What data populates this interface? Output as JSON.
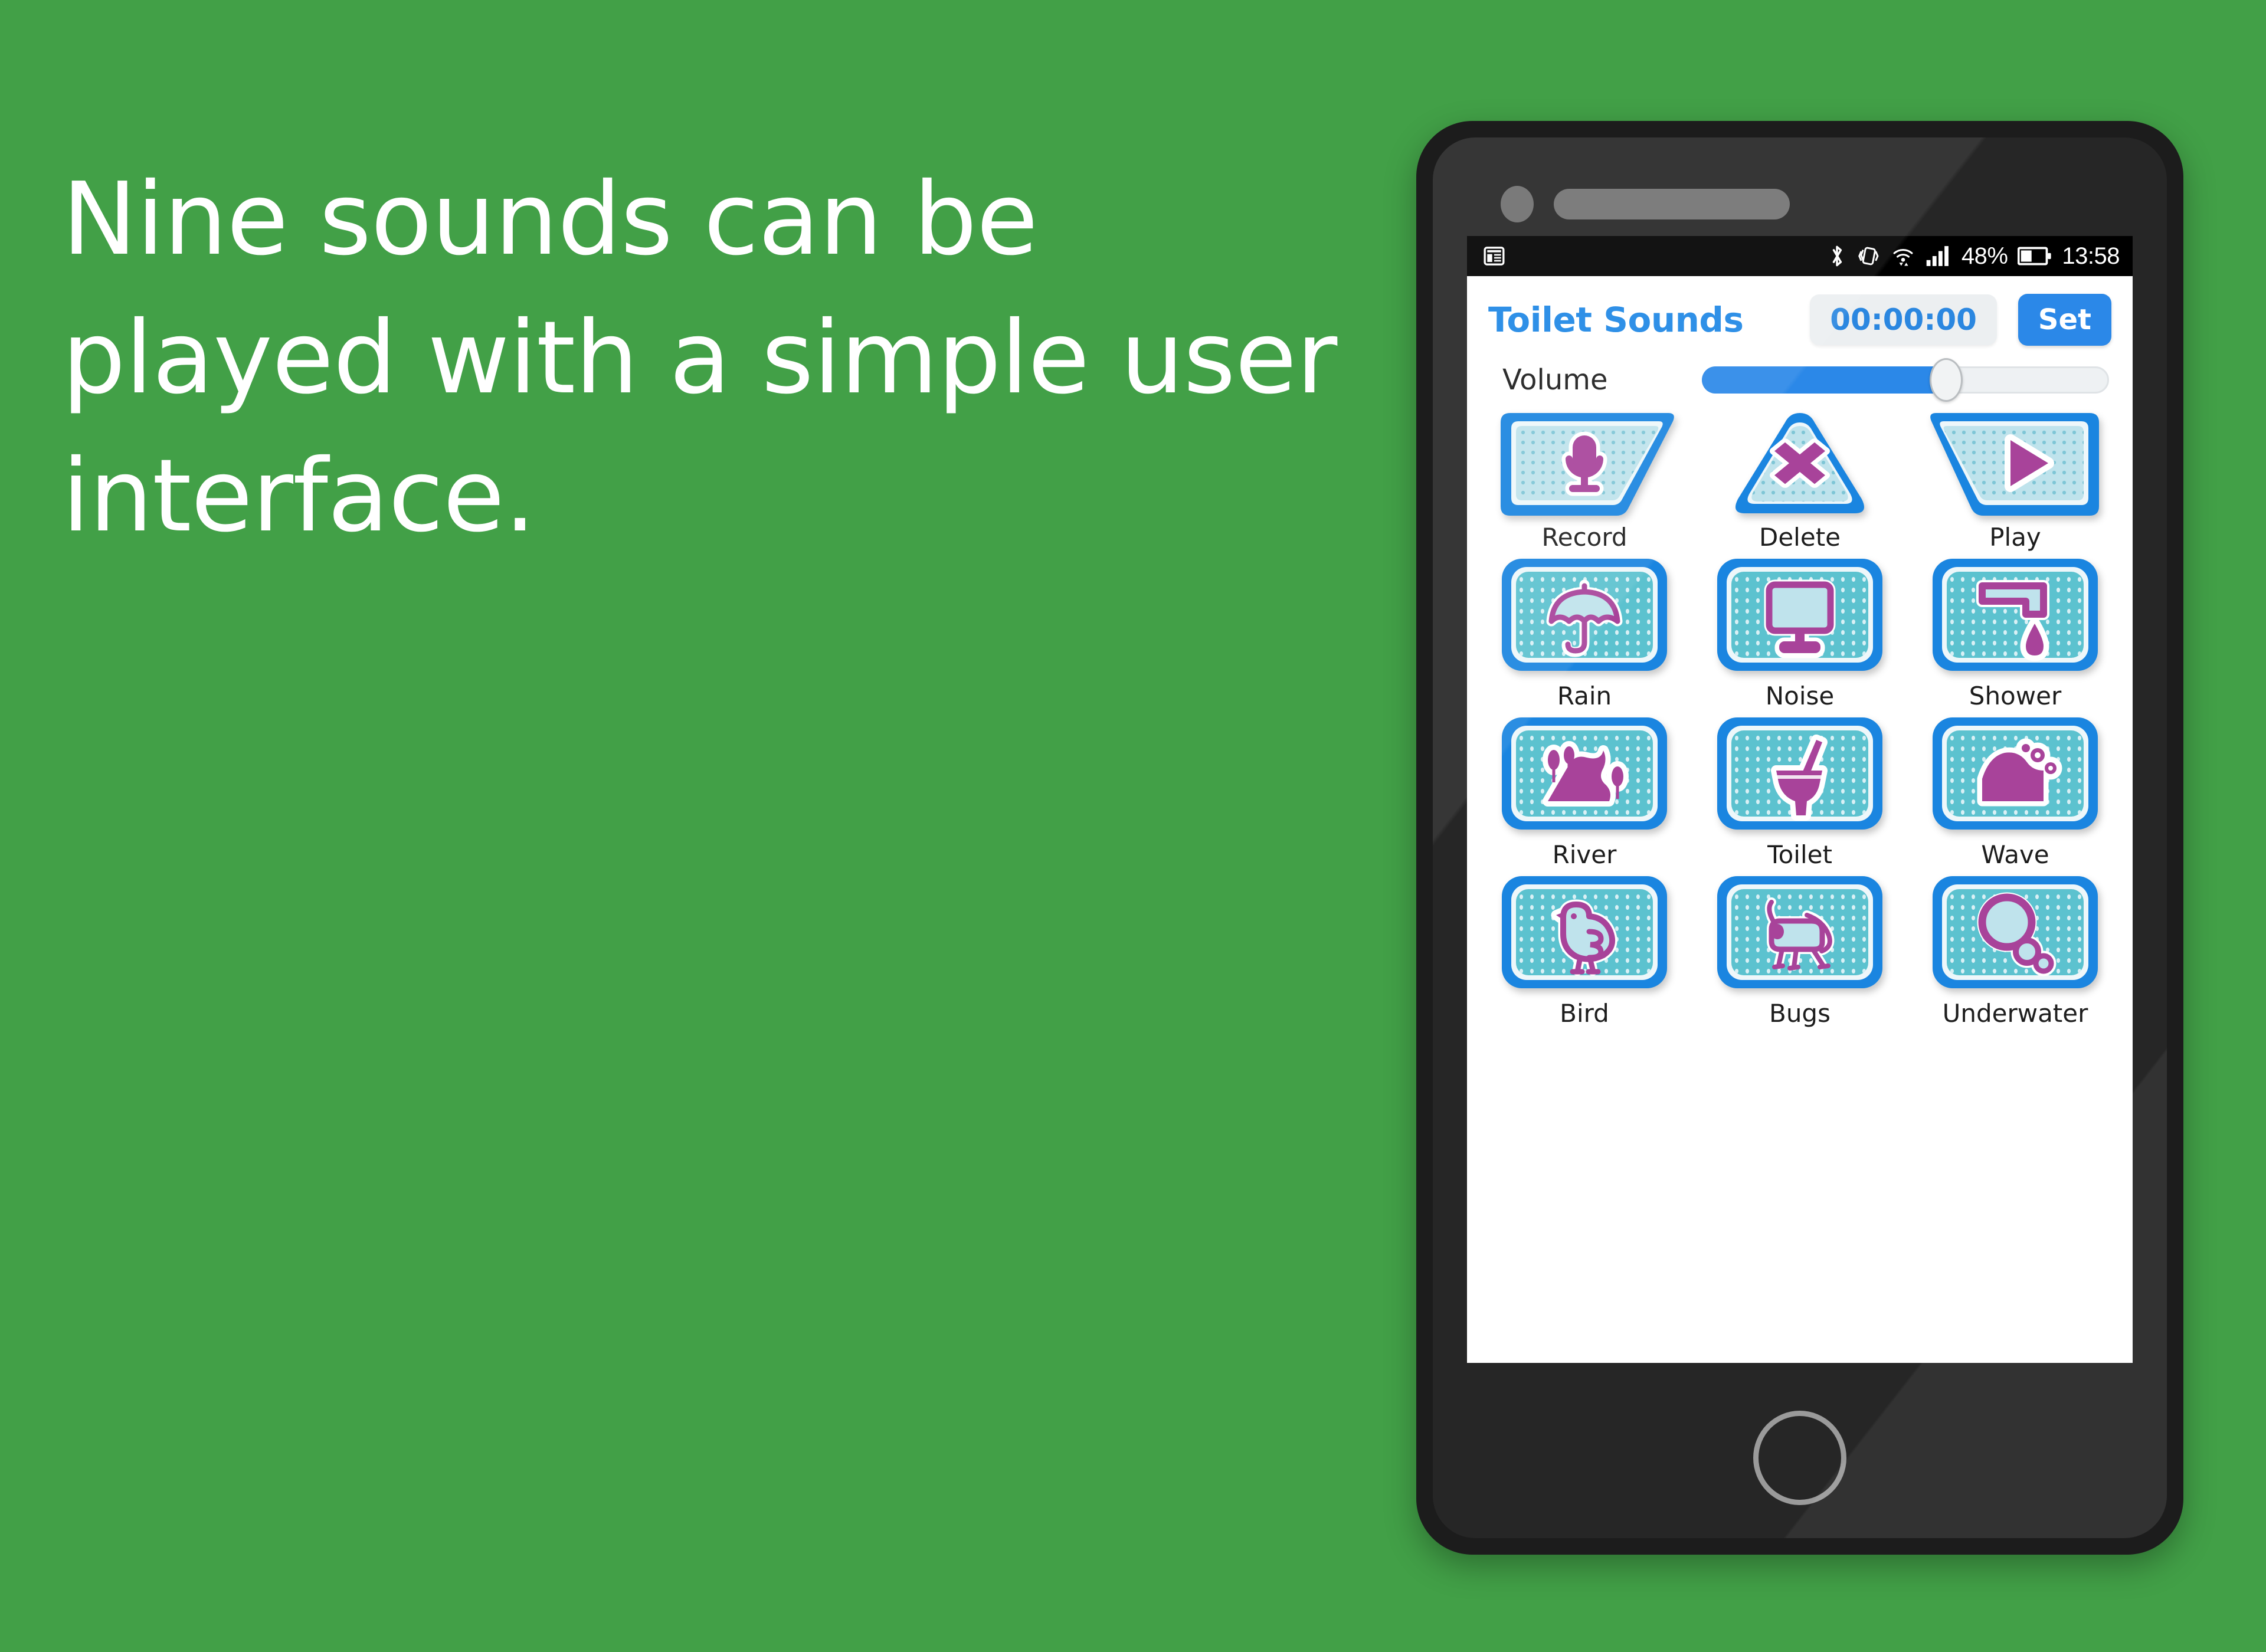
{
  "slide": {
    "headline": "Nine sounds can be played with a simple user interface.",
    "background_color": "#42a047"
  },
  "phone": {
    "body_color": "#1c1c1c",
    "camera_icon": "camera-dot-icon",
    "speaker_icon": "speaker-grille-icon",
    "home_button_icon": "home-button-icon"
  },
  "status_bar": {
    "left_icon": "news-notification-icon",
    "icons": [
      "bluetooth-icon",
      "vibrate-icon",
      "wifi-icon",
      "signal-bars-icon"
    ],
    "battery_percent": "48%",
    "battery_icon": "battery-icon",
    "time": "13:58"
  },
  "app": {
    "title": "Toilet Sounds",
    "timer": "00:00:00",
    "set_label": "Set",
    "accent_blue": "#2b88e8",
    "title_blue": "#1e87e5",
    "volume": {
      "label": "Volume",
      "fill_percent": 60
    },
    "transport_buttons": [
      {
        "label": "Record",
        "icon": "microphone-icon",
        "shape": "trapezoid-right"
      },
      {
        "label": "Delete",
        "icon": "x-cross-icon",
        "shape": "triangle"
      },
      {
        "label": "Play",
        "icon": "play-triangle-icon",
        "shape": "trapezoid-left"
      }
    ],
    "sound_buttons": [
      {
        "label": "Rain",
        "icon": "umbrella-icon"
      },
      {
        "label": "Noise",
        "icon": "tv-monitor-icon"
      },
      {
        "label": "Shower",
        "icon": "faucet-drip-icon"
      },
      {
        "label": "River",
        "icon": "river-mountain-icon"
      },
      {
        "label": "Toilet",
        "icon": "toilet-bowl-icon"
      },
      {
        "label": "Wave",
        "icon": "ocean-wave-icon"
      },
      {
        "label": "Bird",
        "icon": "bird-chick-icon"
      },
      {
        "label": "Bugs",
        "icon": "cricket-bug-icon"
      },
      {
        "label": "Underwater",
        "icon": "bubbles-icon"
      }
    ],
    "button_colors": {
      "border_blue": "#1a85e0",
      "fill_teal": "#5cc2cf",
      "fill_teal_light": "#bfe3ec",
      "icon_purple": "#a8439a",
      "icon_outline": "#ffffff"
    }
  }
}
